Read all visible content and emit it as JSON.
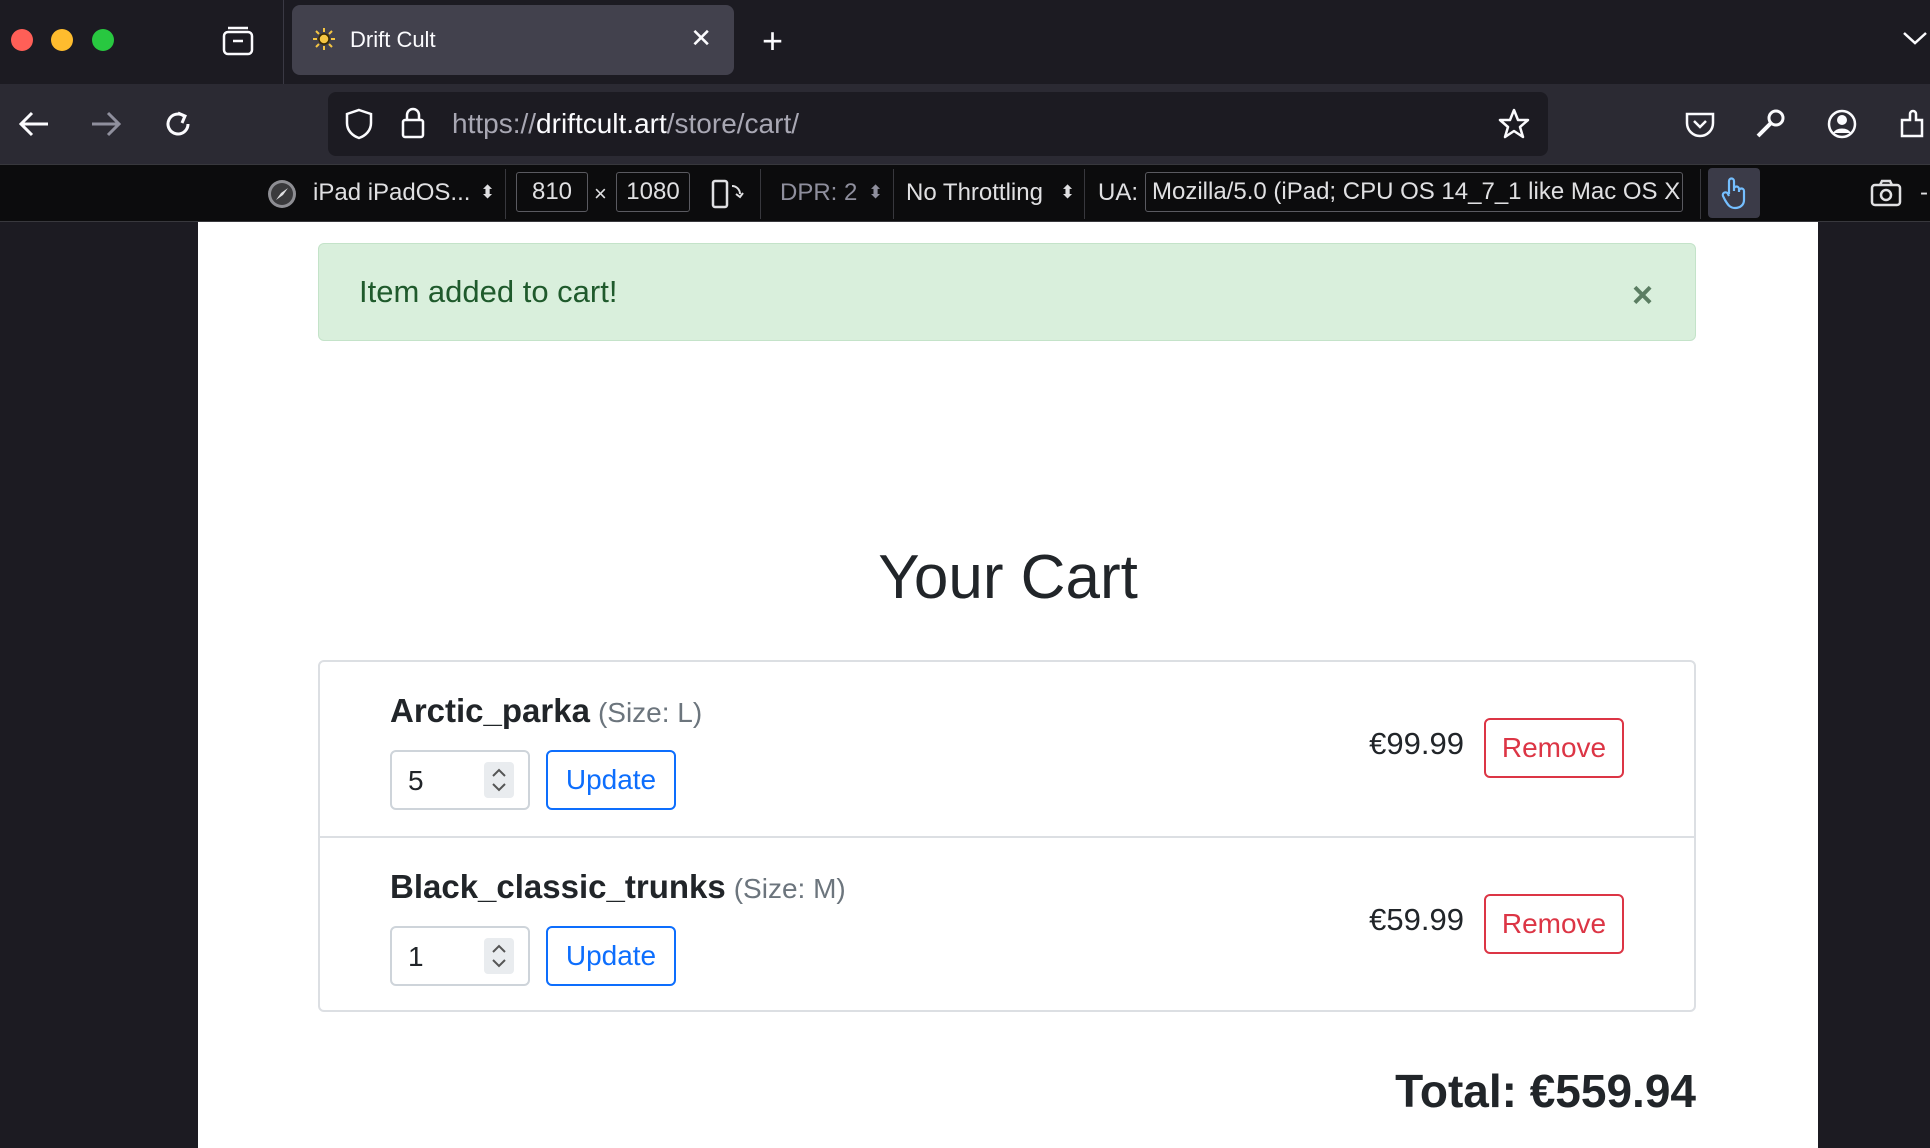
{
  "browser": {
    "tab_title": "Drift Cult",
    "url_scheme": "https://",
    "url_domain": "driftcult.art",
    "url_path": "/store/cart/"
  },
  "devtools": {
    "device": "iPad iPadOS...",
    "width": "810",
    "times": "×",
    "height": "1080",
    "dpr": "DPR: 2",
    "throttling": "No Throttling",
    "ua_label": "UA:",
    "ua_value": "Mozilla/5.0 (iPad; CPU OS 14_7_1 like Mac OS X"
  },
  "alert": {
    "message": "Item added to cart!",
    "close": "×"
  },
  "cart": {
    "title": "Your Cart",
    "items": [
      {
        "name": "Arctic_parka",
        "size": "(Size: L)",
        "qty": "5",
        "update": "Update",
        "price": "€99.99",
        "remove": "Remove"
      },
      {
        "name": "Black_classic_trunks",
        "size": "(Size: M)",
        "qty": "1",
        "update": "Update",
        "price": "€59.99",
        "remove": "Remove"
      }
    ],
    "total": "Total: €559.94"
  },
  "colors": {
    "alert_bg": "#d9efdc",
    "primary": "#0d6efd",
    "danger": "#dc3545"
  }
}
